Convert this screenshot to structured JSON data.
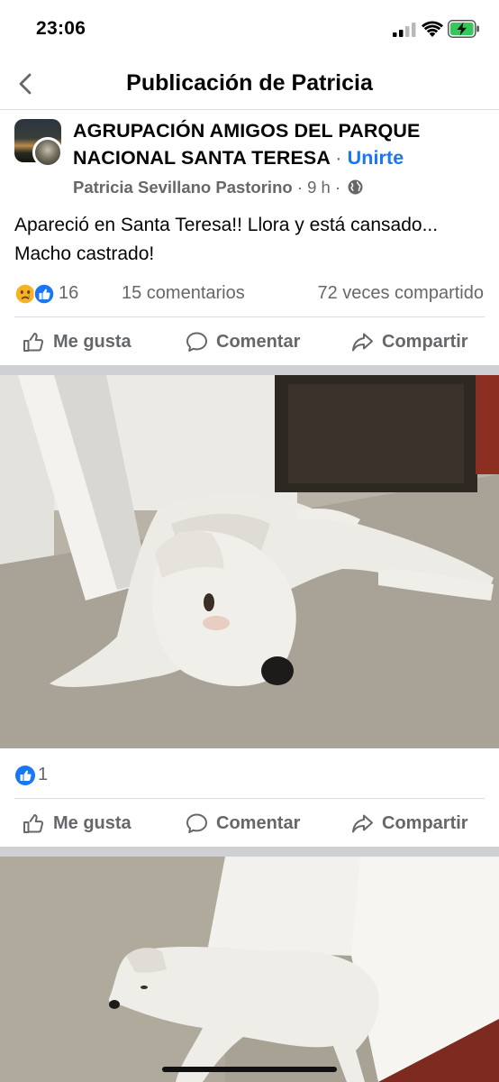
{
  "status_bar": {
    "time": "23:06"
  },
  "nav": {
    "title": "Publicación de Patricia"
  },
  "post": {
    "group_name": "AGRUPACIÓN AMIGOS DEL PARQUE NACIONAL SANTA TERESA",
    "dot": "·",
    "join_label": "Unirte",
    "author": "Patricia Sevillano Pastorino",
    "time_ago": "9 h",
    "text": "Apareció en Santa Teresa!! Llora y está cansado... Macho castrado!",
    "reaction_count": "16",
    "comments": "15 comentarios",
    "shares": "72 veces compartido"
  },
  "actions": {
    "like_label": "Me gusta",
    "comment_label": "Comentar",
    "share_label": "Compartir"
  },
  "photos": [
    {
      "reaction_count": "1"
    }
  ],
  "colors": {
    "brand_blue": "#1877f2",
    "secondary_text": "#65676b",
    "separator": "#ced0d4",
    "battery_green": "#34c759"
  },
  "icons": [
    "back-chevron-icon",
    "signal-icon",
    "wifi-icon",
    "battery-charging-icon",
    "globe-icon",
    "sad-reaction-icon",
    "like-reaction-icon",
    "thumbs-up-icon",
    "comment-icon",
    "share-icon"
  ]
}
